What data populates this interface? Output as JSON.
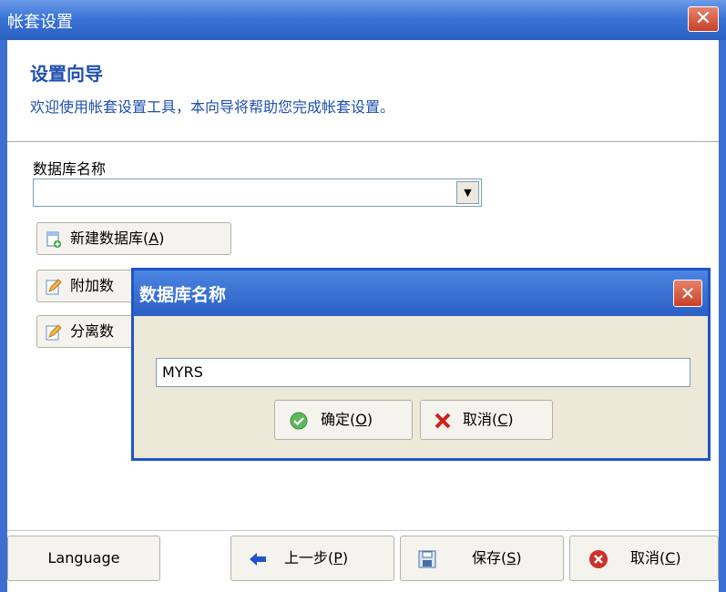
{
  "window": {
    "title": "帐套设置",
    "close_glyph": "✕"
  },
  "header": {
    "title": "设置向导",
    "subtitle": "欢迎使用帐套设置工具，本向导将帮助您完成帐套设置。"
  },
  "database": {
    "label": "数据库名称",
    "value": ""
  },
  "side_buttons": {
    "new_db": {
      "text": "新建数据库(",
      "key": "A",
      "close": ")"
    },
    "attach_db": {
      "text": "附加数"
    },
    "detach_db": {
      "text": "分离数"
    }
  },
  "dialog": {
    "title": "数据库名称",
    "input_value": "MYRS",
    "ok": {
      "text": "确定(",
      "key": "O",
      "close": ")"
    },
    "cancel": {
      "text": "取消(",
      "key": "C",
      "close": ")"
    }
  },
  "footer": {
    "language": "Language",
    "prev": {
      "text": "上一步(",
      "key": "P",
      "close": ")"
    },
    "save": {
      "text": "保存(",
      "key": "S",
      "close": ")"
    },
    "cancel": {
      "text": "取消(",
      "key": "C",
      "close": ")"
    }
  },
  "colors": {
    "title_bar": "#3b75d6",
    "heading_text": "#1f4fae",
    "dialog_border": "#1f55c8",
    "dialog_bg": "#ece9d8"
  }
}
